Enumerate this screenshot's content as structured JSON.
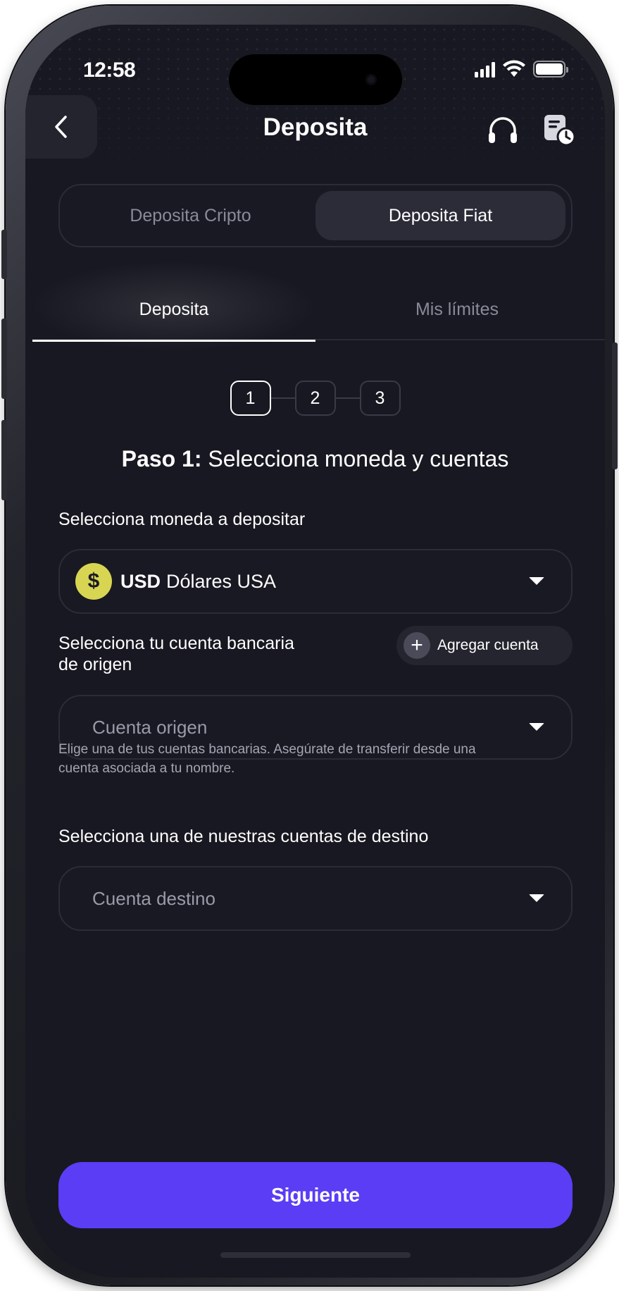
{
  "status_bar": {
    "time": "12:58"
  },
  "header": {
    "title": "Deposita",
    "back_icon": "chevron-left-icon",
    "support_icon": "headset-icon",
    "history_icon": "document-clock-icon"
  },
  "segment": {
    "options": [
      {
        "label": "Deposita Cripto",
        "active": false
      },
      {
        "label": "Deposita Fiat",
        "active": true
      }
    ]
  },
  "tabs": [
    {
      "label": "Deposita",
      "active": true
    },
    {
      "label": "Mis límites",
      "active": false
    }
  ],
  "stepper": {
    "steps": [
      "1",
      "2",
      "3"
    ],
    "current": 1
  },
  "step_title": {
    "prefix": "Paso 1:",
    "text": " Selecciona moneda y cuentas"
  },
  "currency": {
    "label": "Selecciona moneda a depositar",
    "symbol": "$",
    "code": "USD",
    "name": "Dólares USA"
  },
  "origin": {
    "label_line1": "Selecciona tu cuenta bancaria",
    "label_line2": "de origen",
    "add_label": "Agregar cuenta",
    "placeholder": "Cuenta origen",
    "help_line1": "Elige una de tus cuentas bancarias. Asegúrate de transferir desde una",
    "help_line2": "cuenta asociada a tu nombre."
  },
  "destination": {
    "label": "Selecciona una de nuestras cuentas de destino",
    "placeholder": "Cuenta destino"
  },
  "primary_button": {
    "label": "Siguiente"
  },
  "colors": {
    "background": "#181822",
    "surface": "#191923",
    "border": "#2c2c38",
    "accent": "#5a3df5",
    "coin": "#d8d553"
  }
}
